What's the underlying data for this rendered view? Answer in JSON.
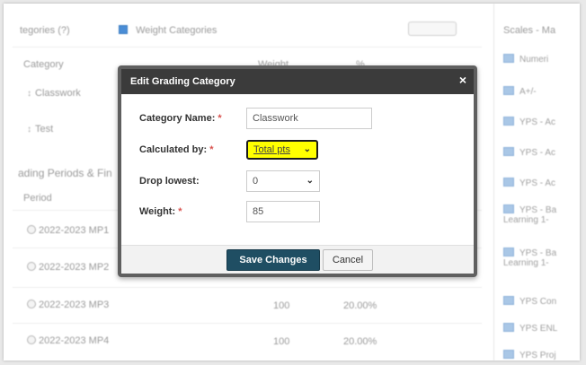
{
  "background": {
    "top_bar": {
      "categories_label": "tegories (?)",
      "weight_checkbox_label": "Weight Categories"
    },
    "categories_table": {
      "headers": [
        "Category",
        "Weight",
        "%"
      ],
      "rows": [
        {
          "name": "Classwork"
        },
        {
          "name": "Test"
        }
      ]
    },
    "grading_periods": {
      "title": "ading Periods & Fin",
      "header": "Period",
      "rows": [
        {
          "period": "2022-2023 MP1",
          "weight": "",
          "percent": ""
        },
        {
          "period": "2022-2023 MP2",
          "weight": "",
          "percent": ""
        },
        {
          "period": "2022-2023 MP3",
          "weight": "100",
          "percent": "20.00%"
        },
        {
          "period": "2022-2023 MP4",
          "weight": "100",
          "percent": "20.00%"
        }
      ]
    },
    "scales": {
      "title": "Scales - Ma",
      "items": [
        "Numeri",
        "A+/-",
        "YPS - Ac",
        "YPS - Ac",
        "YPS - Ac",
        "YPS - Ba Learning 1-",
        "YPS - Ba Learning 1-",
        "YPS Con",
        "YPS ENL",
        "YPS Proj"
      ]
    }
  },
  "dialog": {
    "title": "Edit Grading Category",
    "close_symbol": "×",
    "fields": {
      "category_name": {
        "label": "Category Name:",
        "required_mark": "*",
        "value": "Classwork"
      },
      "calculated_by": {
        "label": "Calculated by:",
        "required_mark": "*",
        "value": "Total pts"
      },
      "drop_lowest": {
        "label": "Drop lowest:",
        "value": "0"
      },
      "weight": {
        "label": "Weight:",
        "required_mark": "*",
        "value": "85"
      }
    },
    "buttons": {
      "save": "Save Changes",
      "cancel": "Cancel"
    }
  },
  "colors": {
    "dialog_header": "#3b3b3b",
    "save_button": "#1f4e63",
    "highlight": "#ffff00"
  }
}
